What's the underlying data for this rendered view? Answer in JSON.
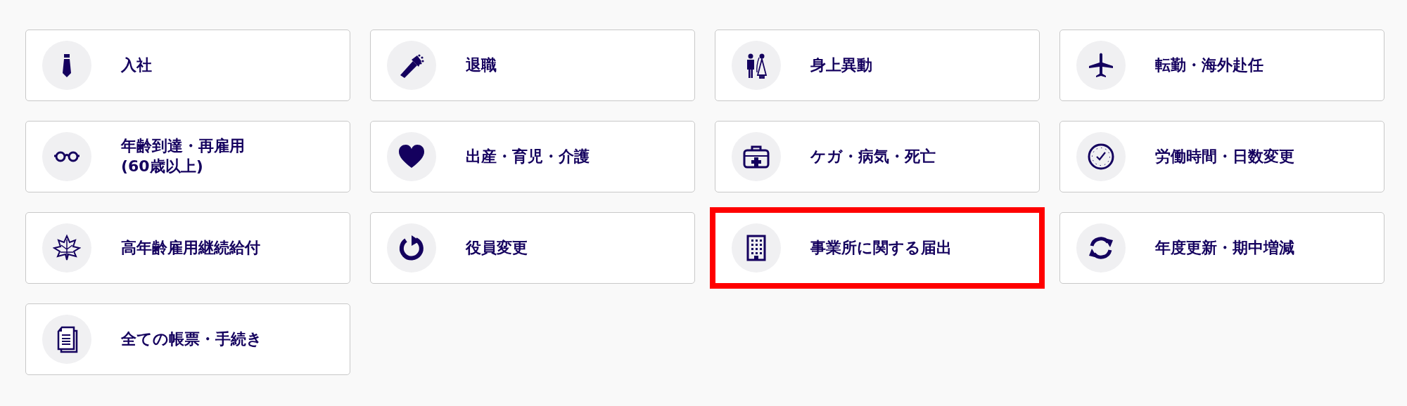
{
  "menu_cards": [
    {
      "label": "入社",
      "highlighted": false
    },
    {
      "label": "退職",
      "highlighted": false
    },
    {
      "label": "身上異動",
      "highlighted": false
    },
    {
      "label": "転勤・海外赴任",
      "highlighted": false
    },
    {
      "label": "年齢到達・再雇用\n(60歳以上)",
      "highlighted": false
    },
    {
      "label": "出産・育児・介護",
      "highlighted": false
    },
    {
      "label": "ケガ・病気・死亡",
      "highlighted": false
    },
    {
      "label": "労働時間・日数変更",
      "highlighted": false
    },
    {
      "label": "高年齢雇用継続給付",
      "highlighted": false
    },
    {
      "label": "役員変更",
      "highlighted": false
    },
    {
      "label": "事業所に関する届出",
      "highlighted": true
    },
    {
      "label": "年度更新・期中増減",
      "highlighted": false
    },
    {
      "label": "全ての帳票・手続き",
      "highlighted": false
    }
  ]
}
